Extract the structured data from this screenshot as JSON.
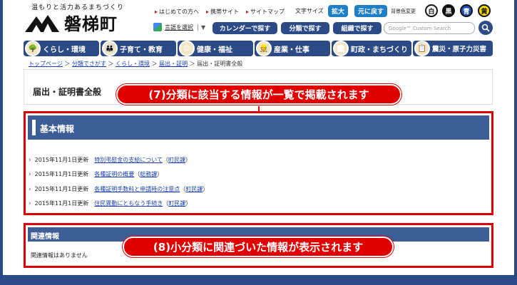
{
  "header": {
    "tagline": "温もりと活力あるまちづくり",
    "logo_text": "磐梯町",
    "links": [
      "はじめての方へ",
      "携帯サイト",
      "サイトマップ"
    ],
    "text_size_label": "文字サイズ",
    "enlarge_label": "拡大",
    "reset_label": "元に戻す",
    "bgcolor_label": "背景色変更",
    "bg_options": [
      {
        "label": "白",
        "bg": "#ffffff",
        "fg": "#111111"
      },
      {
        "label": "黒",
        "bg": "#111111",
        "fg": "#ffffff"
      },
      {
        "label": "青",
        "bg": "#1f4fb8",
        "fg": "#ffffff"
      },
      {
        "label": "黄",
        "bg": "#f5d800",
        "fg": "#111111"
      }
    ],
    "translate_label": "言語を選択",
    "translate_arrow": "▼",
    "nav_buttons": [
      "カレンダーで探す",
      "分類で探す",
      "組織で探す"
    ],
    "search_placeholder": "Google™ Custom Search"
  },
  "categories": [
    {
      "label": "くらし・環境",
      "icon": "🌳"
    },
    {
      "label": "子育て・教育",
      "icon": "👪"
    },
    {
      "label": "健康・福祉",
      "icon": "😊"
    },
    {
      "label": "産業・仕事",
      "icon": "👷"
    },
    {
      "label": "町政・まちづくり",
      "icon": "🏛"
    },
    {
      "label": "震災・原子力災害",
      "icon": "📋"
    }
  ],
  "breadcrumb": {
    "items": [
      "トップページ",
      "分類でさがす",
      "くらし・環境",
      "届出・証明"
    ],
    "sep": "＞",
    "current": "届出・証明書全般"
  },
  "page_title": "届出・証明書全般",
  "callouts": {
    "c7": "(7)分類に該当する情報が一覧で掲載されます",
    "c8": "(8)小分類に関連づいた情報が表示されます"
  },
  "basic_info": {
    "heading": "基本情報",
    "rows": [
      {
        "date": "2015年11月1日更新",
        "title": "特別弔慰金の支給について",
        "dept": "町民課"
      },
      {
        "date": "2015年11月1日更新",
        "title": "各種証明の概要",
        "dept": "総務課"
      },
      {
        "date": "2015年11月1日更新",
        "title": "各種証明手数料と申請時の注意点",
        "dept": "町民課"
      },
      {
        "date": "2015年11月1日更新",
        "title": "住民異動にともなう手続き",
        "dept": "町民課"
      }
    ]
  },
  "related_info": {
    "heading": "関連情報",
    "empty_text": "関連情報はありません"
  },
  "colors": {
    "navy": "#2c4a86",
    "red": "#e00000",
    "link": "#1a3fa8"
  }
}
